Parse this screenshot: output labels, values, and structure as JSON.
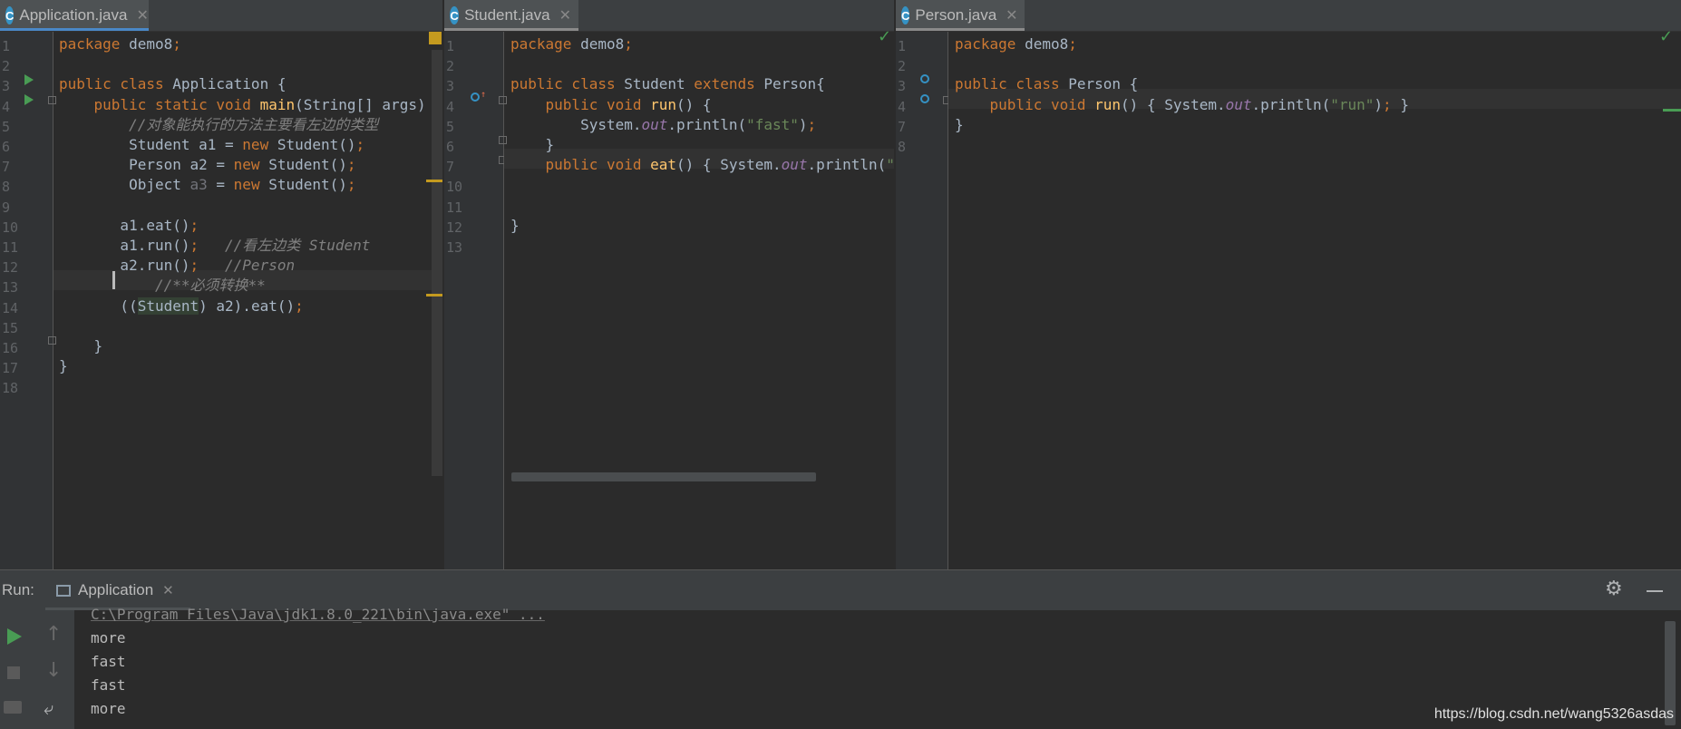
{
  "panes": [
    {
      "tab": {
        "icon": "class-icon",
        "title": "Application.java"
      },
      "line_numbers": [
        "1",
        "2",
        "3",
        "4",
        "5",
        "6",
        "7",
        "8",
        "9",
        "10",
        "11",
        "12",
        "13",
        "14",
        "15",
        "16",
        "17",
        "18"
      ],
      "code_lines": [
        [
          {
            "t": "package ",
            "c": "kw"
          },
          {
            "t": "demo8",
            "c": ""
          },
          {
            "t": ";",
            "c": "kw"
          }
        ],
        [],
        [
          {
            "t": "public class ",
            "c": "kw"
          },
          {
            "t": "Application {",
            "c": ""
          }
        ],
        [
          {
            "t": "    public static void ",
            "c": "kw"
          },
          {
            "t": "main",
            "c": "fn"
          },
          {
            "t": "(String[] args) {",
            "c": ""
          }
        ],
        [
          {
            "t": "        //对象能执行的方法主要看左边的类型",
            "c": "cm"
          }
        ],
        [
          {
            "t": "        Student a1 = ",
            "c": ""
          },
          {
            "t": "new ",
            "c": "kw"
          },
          {
            "t": "Student()",
            "c": ""
          },
          {
            "t": ";",
            "c": "kw"
          }
        ],
        [
          {
            "t": "        Person a2 = ",
            "c": ""
          },
          {
            "t": "new ",
            "c": "kw"
          },
          {
            "t": "Student()",
            "c": ""
          },
          {
            "t": ";",
            "c": "kw"
          }
        ],
        [
          {
            "t": "        Object ",
            "c": ""
          },
          {
            "t": "a3",
            "c": "unused"
          },
          {
            "t": " = ",
            "c": ""
          },
          {
            "t": "new ",
            "c": "kw"
          },
          {
            "t": "Student()",
            "c": ""
          },
          {
            "t": ";",
            "c": "kw"
          }
        ],
        [],
        [
          {
            "t": "       a1.eat()",
            "c": ""
          },
          {
            "t": ";",
            "c": "kw"
          }
        ],
        [
          {
            "t": "       a1.run()",
            "c": ""
          },
          {
            "t": ";   ",
            "c": "kw"
          },
          {
            "t": "//看左边类 Student",
            "c": "cm"
          }
        ],
        [
          {
            "t": "       a2.run()",
            "c": ""
          },
          {
            "t": ";   ",
            "c": "kw"
          },
          {
            "t": "//Person",
            "c": "cm"
          }
        ],
        [
          {
            "t": "           //**必须转换**",
            "c": "cm"
          }
        ],
        [
          {
            "t": "       ((",
            "c": ""
          },
          {
            "t": "Student",
            "c": "hl"
          },
          {
            "t": ") a2).eat()",
            "c": ""
          },
          {
            "t": ";",
            "c": "kw"
          }
        ],
        [],
        [
          {
            "t": "    }",
            "c": ""
          }
        ],
        [
          {
            "t": "}",
            "c": ""
          }
        ],
        []
      ]
    },
    {
      "tab": {
        "icon": "class-icon",
        "title": "Student.java"
      },
      "line_numbers": [
        "1",
        "2",
        "3",
        "4",
        "5",
        "6",
        "7",
        "10",
        "11",
        "12",
        "13"
      ],
      "code_lines": [
        [
          {
            "t": "package ",
            "c": "kw"
          },
          {
            "t": "demo8",
            "c": ""
          },
          {
            "t": ";",
            "c": "kw"
          }
        ],
        [],
        [
          {
            "t": "public class ",
            "c": "kw"
          },
          {
            "t": "Student ",
            "c": ""
          },
          {
            "t": "extends ",
            "c": "kw"
          },
          {
            "t": "Person{",
            "c": ""
          }
        ],
        [
          {
            "t": "    public void ",
            "c": "kw"
          },
          {
            "t": "run",
            "c": "fn"
          },
          {
            "t": "() {",
            "c": ""
          }
        ],
        [
          {
            "t": "        System.",
            "c": ""
          },
          {
            "t": "out",
            "c": "fld"
          },
          {
            "t": ".println(",
            "c": ""
          },
          {
            "t": "\"fast\"",
            "c": "str"
          },
          {
            "t": ")",
            "c": ""
          },
          {
            "t": ";",
            "c": "kw"
          }
        ],
        [
          {
            "t": "    }",
            "c": ""
          }
        ],
        [
          {
            "t": "    public void ",
            "c": "kw"
          },
          {
            "t": "eat",
            "c": "fn"
          },
          {
            "t": "() { System.",
            "c": ""
          },
          {
            "t": "out",
            "c": "fld"
          },
          {
            "t": ".println(",
            "c": ""
          },
          {
            "t": "\"more\"",
            "c": "str"
          },
          {
            "t": ")",
            "c": ""
          }
        ],
        [],
        [],
        [
          {
            "t": "}",
            "c": ""
          }
        ],
        []
      ]
    },
    {
      "tab": {
        "icon": "class-icon",
        "title": "Person.java"
      },
      "line_numbers": [
        "1",
        "2",
        "3",
        "4",
        "7",
        "8"
      ],
      "code_lines": [
        [
          {
            "t": "package ",
            "c": "kw"
          },
          {
            "t": "demo8",
            "c": ""
          },
          {
            "t": ";",
            "c": "kw"
          }
        ],
        [],
        [
          {
            "t": "public class ",
            "c": "kw"
          },
          {
            "t": "Person {",
            "c": ""
          }
        ],
        [
          {
            "t": "    public void ",
            "c": "kw"
          },
          {
            "t": "run",
            "c": "fn"
          },
          {
            "t": "() { System.",
            "c": ""
          },
          {
            "t": "out",
            "c": "fld"
          },
          {
            "t": ".println(",
            "c": ""
          },
          {
            "t": "\"run\"",
            "c": "str"
          },
          {
            "t": ")",
            "c": ""
          },
          {
            "t": "; ",
            "c": "kw"
          },
          {
            "t": "}",
            "c": ""
          }
        ],
        [
          {
            "t": "}",
            "c": ""
          }
        ],
        []
      ]
    }
  ],
  "run_panel": {
    "label": "Run:",
    "tab_title": "Application",
    "tab_icon": "console-icon",
    "settings_icon": "gear-icon",
    "minimize_icon": "minimize-icon",
    "toolbar_icons": [
      "run-icon",
      "up-arrow-icon",
      "stop-icon",
      "down-arrow-icon",
      "camera-icon",
      "soft-wrap-icon"
    ],
    "console_lines": [
      "C:\\Program Files\\Java\\jdk1.8.0_221\\bin\\java.exe\" ...",
      "more",
      "fast",
      "fast",
      "more"
    ]
  },
  "watermark": "https://blog.csdn.net/wang5326asdas",
  "colors": {
    "keyword": "#cc7832",
    "function": "#ffc66d",
    "string": "#6a8759",
    "comment": "#808080",
    "field": "#9876aa",
    "text": "#a9b7c6",
    "background": "#2b2b2b",
    "accent": "#4a88c7",
    "ok": "#499c54"
  }
}
